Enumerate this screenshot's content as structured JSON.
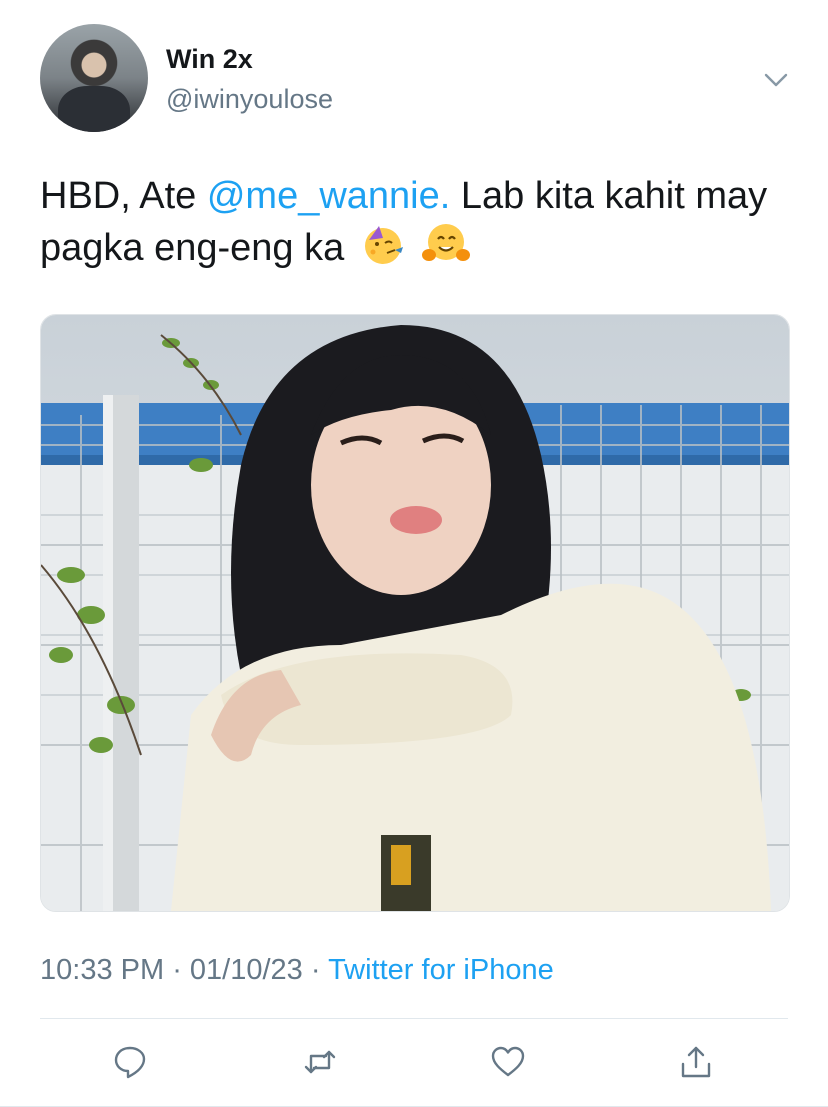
{
  "tweet": {
    "display_name": "Win 2x",
    "handle": "@iwinyoulose",
    "text_part1": "HBD, Ate ",
    "mention": "@me_wannie.",
    "text_part2": " Lab kita kahit may pagka eng-eng ka",
    "emojis": [
      "partying-face-emoji",
      "hugging-face-emoji"
    ],
    "media_description_icon": "photo-of-woman-in-fleece-jacket",
    "time": "10:33 PM",
    "separator": " · ",
    "date": "01/10/23",
    "source": "Twitter for iPhone"
  },
  "actions": {
    "icons": [
      "reply-icon",
      "retweet-icon",
      "like-icon",
      "share-icon"
    ]
  },
  "colors": {
    "accent": "#1da1f2",
    "secondary_text": "#657786",
    "primary_text": "#14171a",
    "divider": "#e1e8ed"
  }
}
